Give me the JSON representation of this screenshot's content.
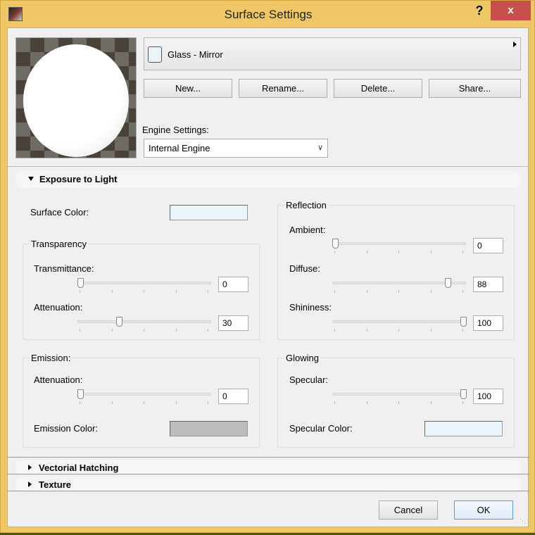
{
  "window": {
    "title": "Surface Settings",
    "help": "?",
    "close": "x"
  },
  "surface": {
    "name": "Glass - Mirror",
    "swatch_color": "#eaf4fb"
  },
  "buttons": {
    "new": "New...",
    "rename": "Rename...",
    "delete": "Delete...",
    "share": "Share..."
  },
  "engine": {
    "label": "Engine Settings:",
    "value": "Internal Engine"
  },
  "sections": {
    "exposure": "Exposure to Light",
    "hatching": "Vectorial Hatching",
    "texture": "Texture"
  },
  "surface_color": {
    "label": "Surface Color:",
    "color": "#eaf4fb"
  },
  "transparency": {
    "title": "Transparency",
    "transmittance": {
      "label": "Transmittance:",
      "value": "0"
    },
    "attenuation": {
      "label": "Attenuation:",
      "value": "30"
    }
  },
  "reflection": {
    "title": "Reflection",
    "ambient": {
      "label": "Ambient:",
      "value": "0"
    },
    "diffuse": {
      "label": "Diffuse:",
      "value": "88"
    },
    "shininess": {
      "label": "Shininess:",
      "value": "100"
    }
  },
  "emission": {
    "title": "Emission:",
    "attenuation": {
      "label": "Attenuation:",
      "value": "0"
    },
    "color_label": "Emission Color:",
    "color": "#bdbdbd"
  },
  "glowing": {
    "title": "Glowing",
    "specular": {
      "label": "Specular:",
      "value": "100"
    },
    "color_label": "Specular Color:",
    "color": "#eaf4fb"
  },
  "footer": {
    "cancel": "Cancel",
    "ok": "OK"
  }
}
